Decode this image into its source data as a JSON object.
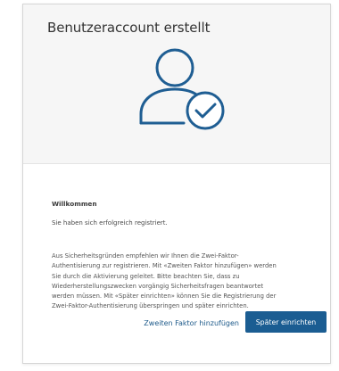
{
  "dialog": {
    "title": "Benutzeraccount erstellt",
    "icon": "user-check-icon",
    "accent_color": "#1b5d92",
    "icon_color": "#1f5e93"
  },
  "content": {
    "heading": "Willkommen",
    "success_message": "Sie haben sich erfolgreich registriert.",
    "info_lines": [
      "Aus Sicherheitsgründen empfehlen wir Ihnen die Zwei-Faktor-",
      "Authentisierung zur registrieren. Mit «Zweiten Faktor hinzufügen» werden",
      "Sie durch die Aktivierung geleitet. Bitte beachten Sie, dass zu",
      "Wiederherstellungszwecken vorgängig Sicherheitsfragen beantwortet",
      "werden müssen. Mit «Später einrichten» können Sie die Registrierung der",
      "Zwei-Faktor-Authentisierung überspringen und später einrichten."
    ]
  },
  "actions": {
    "add_second_factor_label": "Zweiten Faktor hinzufügen",
    "setup_later_label": "Später einrichten"
  }
}
